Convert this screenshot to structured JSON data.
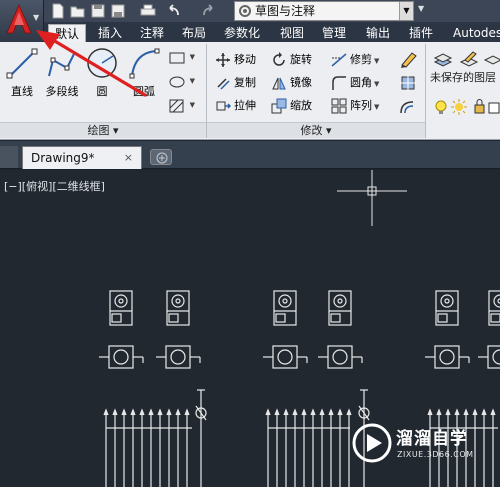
{
  "quick_access": {
    "workspace": "草图与注释",
    "icons": [
      "new-icon",
      "open-icon",
      "save-icon",
      "save-as-icon",
      "print-icon",
      "undo-icon",
      "redo-icon",
      "gear-icon"
    ]
  },
  "tabs": [
    "默认",
    "插入",
    "注释",
    "布局",
    "参数化",
    "视图",
    "管理",
    "输出",
    "插件",
    "Autodes"
  ],
  "active_tab": "默认",
  "draw_panel": {
    "title": "绘图",
    "tools": {
      "line": "直线",
      "polyline": "多段线",
      "circle": "圆",
      "arc": "圆弧"
    }
  },
  "modify_panel": {
    "title": "修改",
    "tools": {
      "move": "移动",
      "rotate": "旋转",
      "trim": "修剪",
      "copy": "复制",
      "mirror": "镜像",
      "fillet": "圆角",
      "stretch": "拉伸",
      "scale": "缩放",
      "array": "阵列"
    }
  },
  "layer_panel": {
    "state": "未保存的图层"
  },
  "document": {
    "tab_title": "Drawing9*",
    "close": "×"
  },
  "viewport": {
    "label": "[−][俯视][二维线框]"
  },
  "watermark": {
    "title": "溜溜自学",
    "url": "ZIXUE.3D66.COM"
  },
  "colors": {
    "accent_red": "#e02020",
    "canvas": "#212830",
    "tab_active": "#eef0f3",
    "ribbon": "#eceef1"
  }
}
